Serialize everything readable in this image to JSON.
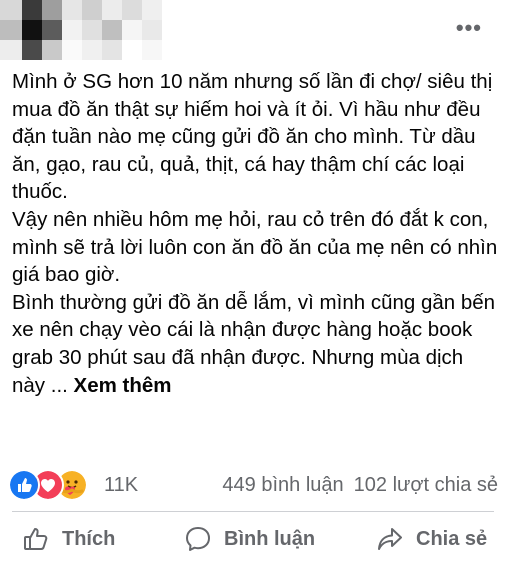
{
  "post": {
    "paragraphs": [
      "Mình ở SG hơn 10 năm nhưng số lần đi chợ/ siêu thị mua đồ ăn thật sự hiếm hoi và ít ỏi. Vì hầu như đều đặn tuần nào mẹ cũng gửi đồ ăn cho mình. Từ dầu ăn, gạo, rau củ, quả, thịt, cá hay thậm chí các loại thuốc.",
      "Vậy nên nhiều hôm mẹ hỏi, rau cỏ trên đó đắt k con, mình sẽ trả lời luôn con ăn đồ ăn của mẹ nên có nhìn giá bao giờ."
    ],
    "last_paragraph": "Bình thường gửi đồ ăn dễ lắm, vì mình cũng gần bến xe nên chạy vèo cái là nhận được hàng hoặc book grab 30 phút sau đã nhận được. Nhưng mùa dịch này ...",
    "see_more": "Xem thêm"
  },
  "stats": {
    "reaction_count": "11K",
    "comments": "449 bình luận",
    "shares": "102 lượt chia sẻ"
  },
  "actions": {
    "like": "Thích",
    "comment": "Bình luận",
    "share": "Chia sẻ"
  },
  "colors": {
    "text": "#050505",
    "secondary": "#65676b",
    "like_blue": "#1877f2",
    "love_red": "#f33e58",
    "care_yellow": "#f7b125"
  },
  "icons": [
    "more-icon",
    "like-reaction-icon",
    "love-reaction-icon",
    "care-reaction-icon",
    "like-icon",
    "comment-icon",
    "share-icon"
  ]
}
